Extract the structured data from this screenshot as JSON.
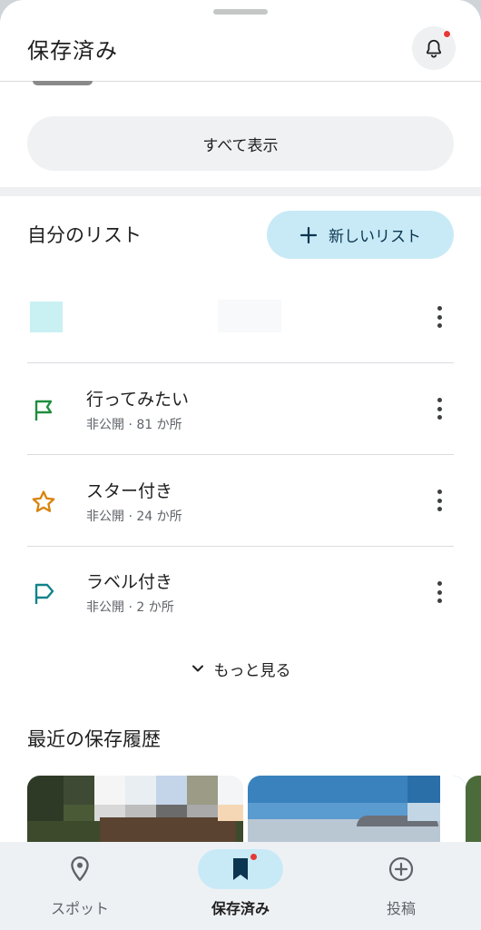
{
  "header": {
    "title": "保存済み",
    "bell_icon": "bell-icon",
    "has_notification": true
  },
  "saved_section": {
    "show_all_label": "すべて表示"
  },
  "my_lists": {
    "title": "自分のリスト",
    "new_list_label": "新しいリスト",
    "items": [
      {
        "name": "",
        "meta": "",
        "icon": "redacted-thumbnail"
      },
      {
        "name": "行ってみたい",
        "meta": "非公開 · 81 か所",
        "icon": "flag-icon",
        "icon_color": "#1e8e3e"
      },
      {
        "name": "スター付き",
        "meta": "非公開 · 24 か所",
        "icon": "star-icon",
        "icon_color": "#d9820b"
      },
      {
        "name": "ラベル付き",
        "meta": "非公開 · 2 か所",
        "icon": "label-flag-icon",
        "icon_color": "#12838a"
      }
    ],
    "more_label": "もっと見る"
  },
  "recent": {
    "title": "最近の保存履歴"
  },
  "bottom_nav": {
    "items": [
      {
        "label": "スポット",
        "icon": "location-pin-icon",
        "active": false
      },
      {
        "label": "保存済み",
        "icon": "bookmark-icon",
        "active": true
      },
      {
        "label": "投稿",
        "icon": "add-circle-icon",
        "active": false
      }
    ]
  },
  "colors": {
    "accent_pill": "#c8eaf6",
    "notification_dot": "#e53935"
  }
}
